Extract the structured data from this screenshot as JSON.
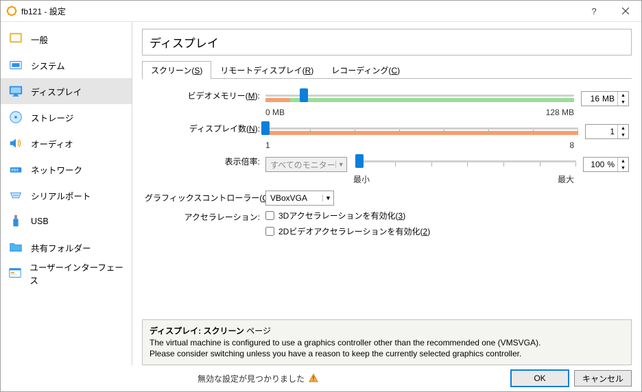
{
  "window": {
    "title": "fb121 - 設定",
    "help": "?",
    "close": "×"
  },
  "sidebar": {
    "items": [
      {
        "label": "一般"
      },
      {
        "label": "システム"
      },
      {
        "label": "ディスプレイ"
      },
      {
        "label": "ストレージ"
      },
      {
        "label": "オーディオ"
      },
      {
        "label": "ネットワーク"
      },
      {
        "label": "シリアルポート"
      },
      {
        "label": "USB"
      },
      {
        "label": "共有フォルダー"
      },
      {
        "label": "ユーザーインターフェース"
      }
    ],
    "selected_index": 2
  },
  "header": {
    "title": "ディスプレイ"
  },
  "tabs": {
    "items": [
      {
        "pre": "スクリーン(",
        "mn": "S",
        "post": ")",
        "active": true
      },
      {
        "pre": "リモートディスプレイ(",
        "mn": "R",
        "post": ")",
        "active": false
      },
      {
        "pre": "レコーディング(",
        "mn": "C",
        "post": ")",
        "active": false
      }
    ]
  },
  "screen": {
    "video_memory": {
      "label_pre": "ビデオメモリー(",
      "label_mn": "M",
      "label_post": "):",
      "value": "16",
      "unit": "MB",
      "min": "0 MB",
      "max": "128 MB",
      "handle_pct": 12.5
    },
    "display_count": {
      "label_pre": "ディスプレイ数(",
      "label_mn": "N",
      "label_post": "):",
      "value": "1",
      "min": "1",
      "max": "8",
      "handle_pct": 0
    },
    "scale_factor": {
      "label": "表示倍率:",
      "monitor": "すべてのモニター",
      "value": "100",
      "unit": "%",
      "min": "最小",
      "max": "最大",
      "handle_pct": 0
    },
    "gfx_controller": {
      "label_pre": "グラフィックスコントローラー(",
      "label_mn": "G",
      "label_post": "):",
      "value": "VBoxVGA"
    },
    "accel": {
      "label": "アクセラレーション:",
      "cb3d_pre": "3Dアクセラレーションを有効化(",
      "cb3d_mn": "3",
      "cb3d_post": ")",
      "cb2d_pre": "2Dビデオアクセラレーションを有効化(",
      "cb2d_mn": "2",
      "cb2d_post": ")"
    }
  },
  "helpbox": {
    "title": "ディスプレイ: スクリーン",
    "title_suffix": " ページ",
    "line1": "The virtual machine is configured to use a graphics controller other than the recommended one (VMSVGA).",
    "line2": "Please consider switching unless you have a reason to keep the currently selected graphics controller."
  },
  "footer": {
    "status": "無効な設定が見つかりました",
    "ok": "OK",
    "cancel": "キャンセル"
  }
}
